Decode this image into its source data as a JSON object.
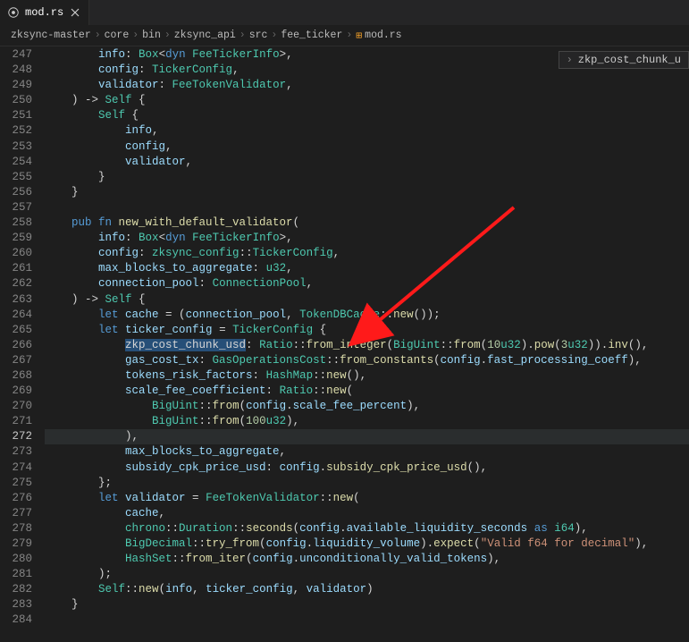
{
  "tab": {
    "filename": "mod.rs"
  },
  "breadcrumb": {
    "parts": [
      "zksync-master",
      "core",
      "bin",
      "zksync_api",
      "src",
      "fee_ticker",
      "mod.rs"
    ]
  },
  "tip": {
    "text": "zkp_cost_chunk_u"
  },
  "gutter": {
    "start": 247,
    "end": 284,
    "current": 272
  },
  "code": {
    "lines": [
      [
        [
          "        ",
          ""
        ],
        [
          "info",
          "var"
        ],
        [
          ": ",
          ""
        ],
        [
          "Box",
          "ty"
        ],
        [
          "<",
          ""
        ],
        [
          "dyn ",
          "kw"
        ],
        [
          "FeeTickerInfo",
          "ty"
        ],
        [
          ">,",
          ""
        ]
      ],
      [
        [
          "        ",
          ""
        ],
        [
          "config",
          "var"
        ],
        [
          ": ",
          ""
        ],
        [
          "TickerConfig",
          "ty"
        ],
        [
          ",",
          ""
        ]
      ],
      [
        [
          "        ",
          ""
        ],
        [
          "validator",
          "var"
        ],
        [
          ": ",
          ""
        ],
        [
          "FeeTokenValidator",
          "ty"
        ],
        [
          ",",
          ""
        ]
      ],
      [
        [
          "    ) -> ",
          ""
        ],
        [
          "Self",
          "ty"
        ],
        [
          " {",
          ""
        ]
      ],
      [
        [
          "        ",
          ""
        ],
        [
          "Self",
          "ty"
        ],
        [
          " {",
          ""
        ]
      ],
      [
        [
          "            ",
          ""
        ],
        [
          "info",
          "var"
        ],
        [
          ",",
          ""
        ]
      ],
      [
        [
          "            ",
          ""
        ],
        [
          "config",
          "var"
        ],
        [
          ",",
          ""
        ]
      ],
      [
        [
          "            ",
          ""
        ],
        [
          "validator",
          "var"
        ],
        [
          ",",
          ""
        ]
      ],
      [
        [
          "        }",
          ""
        ]
      ],
      [
        [
          "    }",
          ""
        ]
      ],
      [
        [
          "",
          ""
        ]
      ],
      [
        [
          "    ",
          ""
        ],
        [
          "pub fn ",
          "kw"
        ],
        [
          "new_with_default_validator",
          "fn"
        ],
        [
          "(",
          ""
        ]
      ],
      [
        [
          "        ",
          ""
        ],
        [
          "info",
          "var"
        ],
        [
          ": ",
          ""
        ],
        [
          "Box",
          "ty"
        ],
        [
          "<",
          ""
        ],
        [
          "dyn ",
          "kw"
        ],
        [
          "FeeTickerInfo",
          "ty"
        ],
        [
          ">,",
          ""
        ]
      ],
      [
        [
          "        ",
          ""
        ],
        [
          "config",
          "var"
        ],
        [
          ": ",
          ""
        ],
        [
          "zksync_config",
          "ns"
        ],
        [
          "::",
          ""
        ],
        [
          "TickerConfig",
          "ty"
        ],
        [
          ",",
          ""
        ]
      ],
      [
        [
          "        ",
          ""
        ],
        [
          "max_blocks_to_aggregate",
          "var"
        ],
        [
          ": ",
          ""
        ],
        [
          "u32",
          "ty"
        ],
        [
          ",",
          ""
        ]
      ],
      [
        [
          "        ",
          ""
        ],
        [
          "connection_pool",
          "var"
        ],
        [
          ": ",
          ""
        ],
        [
          "ConnectionPool",
          "ty"
        ],
        [
          ",",
          ""
        ]
      ],
      [
        [
          "    ) -> ",
          ""
        ],
        [
          "Self",
          "ty"
        ],
        [
          " {",
          ""
        ]
      ],
      [
        [
          "        ",
          ""
        ],
        [
          "let ",
          "kw"
        ],
        [
          "cache",
          "var"
        ],
        [
          " = (",
          ""
        ],
        [
          "connection_pool",
          "var"
        ],
        [
          ", ",
          ""
        ],
        [
          "TokenDBCache",
          "ty"
        ],
        [
          "::",
          ""
        ],
        [
          "new",
          "fn"
        ],
        [
          "());",
          ""
        ]
      ],
      [
        [
          "        ",
          ""
        ],
        [
          "let ",
          "kw"
        ],
        [
          "ticker_config",
          "var"
        ],
        [
          " = ",
          ""
        ],
        [
          "TickerConfig",
          "ty"
        ],
        [
          " {",
          ""
        ]
      ],
      [
        [
          "            ",
          ""
        ],
        [
          "zkp_cost_chunk_usd",
          "sel"
        ],
        [
          ": ",
          ""
        ],
        [
          "Ratio",
          "ty"
        ],
        [
          "::",
          ""
        ],
        [
          "from_integer",
          "fn"
        ],
        [
          "(",
          ""
        ],
        [
          "BigUint",
          "ty"
        ],
        [
          "::",
          ""
        ],
        [
          "from",
          "fn"
        ],
        [
          "(",
          ""
        ],
        [
          "10",
          "num"
        ],
        [
          "u32",
          "ty"
        ],
        [
          ").",
          ""
        ],
        [
          "pow",
          "fn"
        ],
        [
          "(",
          ""
        ],
        [
          "3",
          "num"
        ],
        [
          "u32",
          "ty"
        ],
        [
          ")).",
          ""
        ],
        [
          "inv",
          "fn"
        ],
        [
          "(),",
          ""
        ]
      ],
      [
        [
          "            ",
          ""
        ],
        [
          "gas_cost_tx",
          "var"
        ],
        [
          ": ",
          ""
        ],
        [
          "GasOperationsCost",
          "ty"
        ],
        [
          "::",
          ""
        ],
        [
          "from_constants",
          "fn"
        ],
        [
          "(",
          ""
        ],
        [
          "config",
          "var"
        ],
        [
          ".",
          ""
        ],
        [
          "fast_processing_coeff",
          "var"
        ],
        [
          "),",
          ""
        ]
      ],
      [
        [
          "            ",
          ""
        ],
        [
          "tokens_risk_factors",
          "var"
        ],
        [
          ": ",
          ""
        ],
        [
          "HashMap",
          "ty"
        ],
        [
          "::",
          ""
        ],
        [
          "new",
          "fn"
        ],
        [
          "(),",
          ""
        ]
      ],
      [
        [
          "            ",
          ""
        ],
        [
          "scale_fee_coefficient",
          "var"
        ],
        [
          ": ",
          ""
        ],
        [
          "Ratio",
          "ty"
        ],
        [
          "::",
          ""
        ],
        [
          "new",
          "fn"
        ],
        [
          "(",
          ""
        ]
      ],
      [
        [
          "                ",
          ""
        ],
        [
          "BigUint",
          "ty"
        ],
        [
          "::",
          ""
        ],
        [
          "from",
          "fn"
        ],
        [
          "(",
          ""
        ],
        [
          "config",
          "var"
        ],
        [
          ".",
          ""
        ],
        [
          "scale_fee_percent",
          "var"
        ],
        [
          "),",
          ""
        ]
      ],
      [
        [
          "                ",
          ""
        ],
        [
          "BigUint",
          "ty"
        ],
        [
          "::",
          ""
        ],
        [
          "from",
          "fn"
        ],
        [
          "(",
          ""
        ],
        [
          "100",
          "num"
        ],
        [
          "u32",
          "ty"
        ],
        [
          "),",
          ""
        ]
      ],
      [
        [
          "            ),",
          ""
        ]
      ],
      [
        [
          "            ",
          ""
        ],
        [
          "max_blocks_to_aggregate",
          "var"
        ],
        [
          ",",
          ""
        ]
      ],
      [
        [
          "            ",
          ""
        ],
        [
          "subsidy_cpk_price_usd",
          "var"
        ],
        [
          ": ",
          ""
        ],
        [
          "config",
          "var"
        ],
        [
          ".",
          ""
        ],
        [
          "subsidy_cpk_price_usd",
          "fn"
        ],
        [
          "(),",
          ""
        ]
      ],
      [
        [
          "        };",
          ""
        ]
      ],
      [
        [
          "        ",
          ""
        ],
        [
          "let ",
          "kw"
        ],
        [
          "validator",
          "var"
        ],
        [
          " = ",
          ""
        ],
        [
          "FeeTokenValidator",
          "ty"
        ],
        [
          "::",
          ""
        ],
        [
          "new",
          "fn"
        ],
        [
          "(",
          ""
        ]
      ],
      [
        [
          "            ",
          ""
        ],
        [
          "cache",
          "var"
        ],
        [
          ",",
          ""
        ]
      ],
      [
        [
          "            ",
          ""
        ],
        [
          "chrono",
          "ns"
        ],
        [
          "::",
          ""
        ],
        [
          "Duration",
          "ty"
        ],
        [
          "::",
          ""
        ],
        [
          "seconds",
          "fn"
        ],
        [
          "(",
          ""
        ],
        [
          "config",
          "var"
        ],
        [
          ".",
          ""
        ],
        [
          "available_liquidity_seconds",
          "var"
        ],
        [
          " ",
          ""
        ],
        [
          "as ",
          "kw"
        ],
        [
          "i64",
          "ty"
        ],
        [
          "),",
          ""
        ]
      ],
      [
        [
          "            ",
          ""
        ],
        [
          "BigDecimal",
          "ty"
        ],
        [
          "::",
          ""
        ],
        [
          "try_from",
          "fn"
        ],
        [
          "(",
          ""
        ],
        [
          "config",
          "var"
        ],
        [
          ".",
          ""
        ],
        [
          "liquidity_volume",
          "var"
        ],
        [
          ").",
          ""
        ],
        [
          "expect",
          "fn"
        ],
        [
          "(",
          ""
        ],
        [
          "\"Valid f64 for decimal\"",
          "str"
        ],
        [
          "),",
          ""
        ]
      ],
      [
        [
          "            ",
          ""
        ],
        [
          "HashSet",
          "ty"
        ],
        [
          "::",
          ""
        ],
        [
          "from_iter",
          "fn"
        ],
        [
          "(",
          ""
        ],
        [
          "config",
          "var"
        ],
        [
          ".",
          ""
        ],
        [
          "unconditionally_valid_tokens",
          "var"
        ],
        [
          "),",
          ""
        ]
      ],
      [
        [
          "        );",
          ""
        ]
      ],
      [
        [
          "        ",
          ""
        ],
        [
          "Self",
          "ty"
        ],
        [
          "::",
          ""
        ],
        [
          "new",
          "fn"
        ],
        [
          "(",
          ""
        ],
        [
          "info",
          "var"
        ],
        [
          ", ",
          ""
        ],
        [
          "ticker_config",
          "var"
        ],
        [
          ", ",
          ""
        ],
        [
          "validator",
          "var"
        ],
        [
          ")",
          ""
        ]
      ],
      [
        [
          "    }",
          ""
        ]
      ],
      [
        [
          "",
          ""
        ]
      ]
    ]
  }
}
